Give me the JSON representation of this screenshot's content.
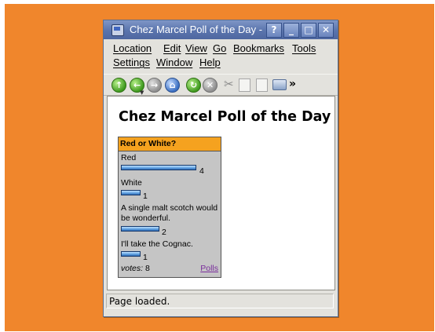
{
  "window": {
    "title": "Chez Marcel Poll of the Day - I",
    "controls": {
      "help": "?",
      "minimize": "_",
      "maximize": "□",
      "close": "✕"
    }
  },
  "menu": {
    "row1": [
      "Location",
      "Edit",
      "View",
      "Go",
      "Bookmarks",
      "Tools"
    ],
    "row2": [
      "Settings",
      "Window",
      "Help"
    ]
  },
  "toolbar": {
    "overflow": "»",
    "icons": [
      "back-icon",
      "forward-icon",
      "up-icon",
      "home-icon",
      "reload-icon",
      "stop-icon",
      "cut-icon",
      "copy-icon",
      "paste-icon",
      "print-icon"
    ]
  },
  "page": {
    "title": "Chez Marcel Poll of the Day"
  },
  "poll": {
    "question": "Red or White?",
    "options": [
      {
        "label": "Red",
        "votes": "4"
      },
      {
        "label": "White",
        "votes": "1"
      },
      {
        "label": "A single malt scotch would be wonderful.",
        "votes": "2"
      },
      {
        "label": "I'll take the Cognac.",
        "votes": "1"
      }
    ],
    "votes_label": "votes:",
    "total": "8",
    "link": "Polls"
  },
  "status": "Page loaded.",
  "colors": {
    "desktop": "#f0862c",
    "titlebar": "#5a74ad",
    "poll_header": "#f5a21f",
    "poll_bg": "#c5c5c5",
    "bar": "#5e9fe0"
  }
}
